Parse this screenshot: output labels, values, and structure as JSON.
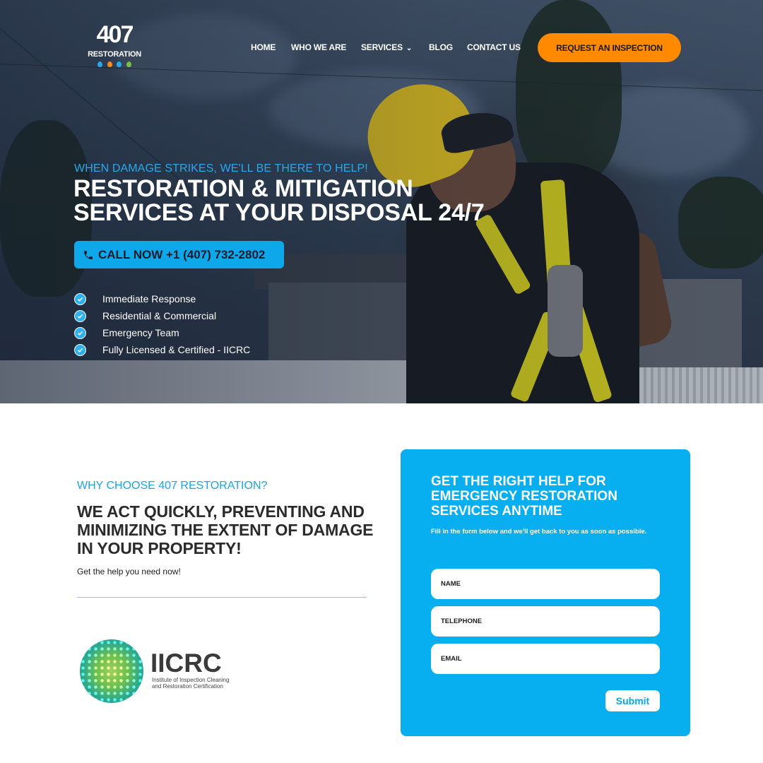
{
  "brand": {
    "logo_number": "407",
    "logo_text": "RESTORATION",
    "logo_dot_colors": [
      "#2aa8e8",
      "#f28a1c",
      "#2aa8e8",
      "#76c043"
    ]
  },
  "nav": {
    "items": [
      {
        "label": "HOME"
      },
      {
        "label": "WHO WE ARE"
      },
      {
        "label": "SERVICES",
        "has_dropdown": true
      },
      {
        "label": "BLOG"
      },
      {
        "label": "CONTACT US"
      }
    ],
    "cta_label": "REQUEST AN INSPECTION"
  },
  "hero": {
    "kicker": "WHEN DAMAGE STRIKES, WE'LL BE THERE TO HELP!",
    "headline_line1": "RESTORATION & MITIGATION",
    "headline_line2": "SERVICES AT YOUR DISPOSAL 24/7",
    "call_label": "CALL NOW +1 (407) 732-2802",
    "features": [
      "Immediate Response",
      "Residential & Commercial",
      "Emergency Team",
      "Fully Licensed & Certified - IICRC"
    ]
  },
  "why": {
    "kicker": "WHY CHOOSE 407 RESTORATION?",
    "headline": "WE ACT QUICKLY, PREVENTING AND MINIMIZING THE EXTENT OF DAMAGE IN YOUR PROPERTY!",
    "sub": "Get the help you need now!"
  },
  "iicrc": {
    "title": "IICRC",
    "sub_line1": "Institute of Inspection Cleaning",
    "sub_line2": "and Restoration Certification"
  },
  "form": {
    "title": "GET THE RIGHT HELP FOR EMERGENCY RESTORATION SERVICES ANYTIME",
    "desc": "Fill in the form below and we'll get back to you as soon as possible.",
    "name_placeholder": "NAME",
    "telephone_placeholder": "TELEPHONE",
    "email_placeholder": "EMAIL",
    "submit_label": "Submit"
  },
  "colors": {
    "accent": "#07aef0",
    "cta_orange": "#ff8a00",
    "divider_gold": "#e3b84a"
  }
}
